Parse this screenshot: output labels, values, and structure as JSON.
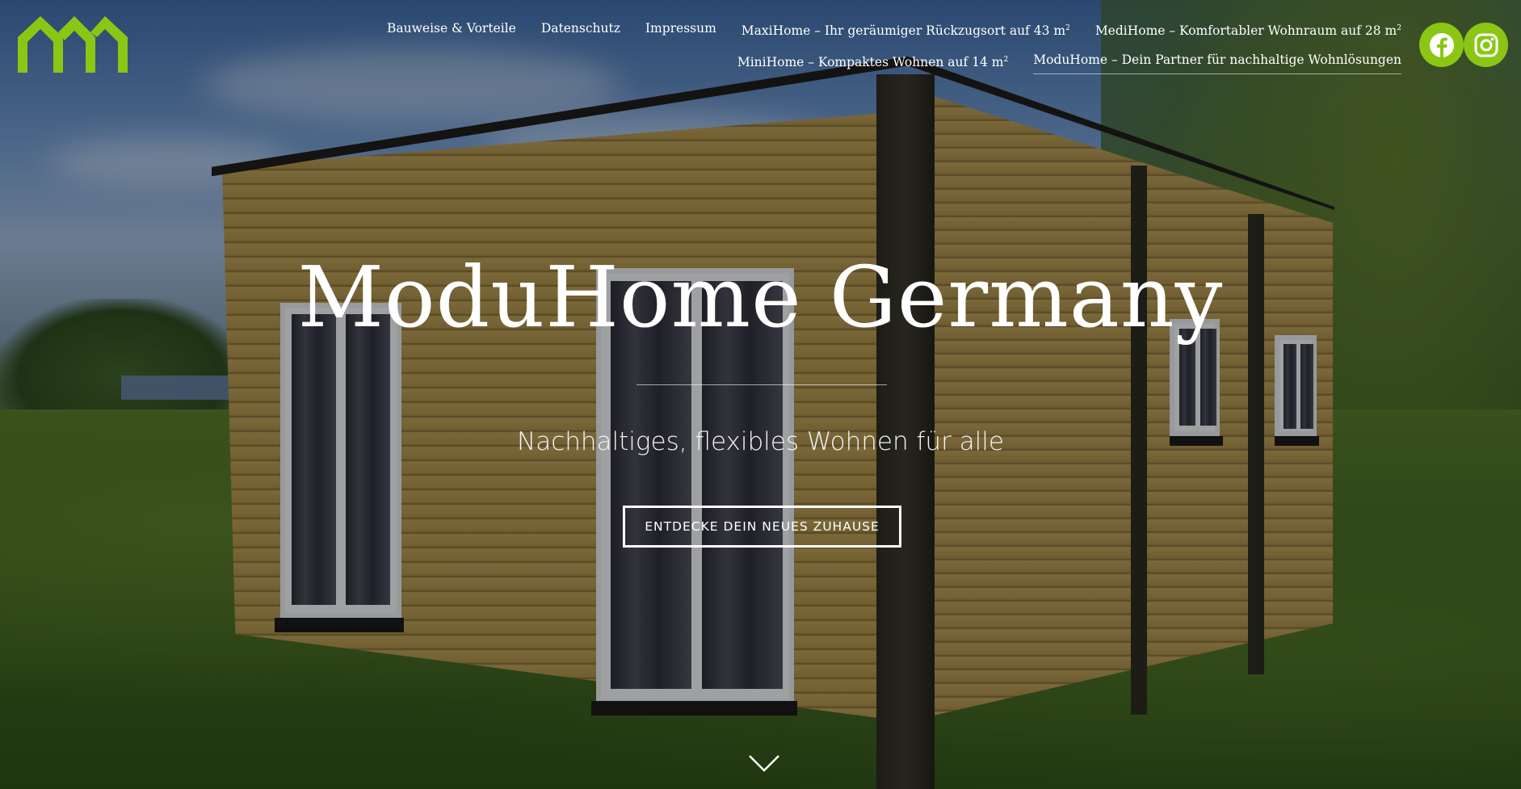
{
  "brand": {
    "logo_icon": "moduhome-logo-icon",
    "accent_color": "#8bc614"
  },
  "nav": {
    "items": [
      {
        "label": "Bauweise & Vorteile"
      },
      {
        "label": "Datenschutz"
      },
      {
        "label": "Impressum"
      },
      {
        "label": "MaxiHome – Ihr geräumiger Rückzugsort auf 43 m",
        "sup": "2"
      },
      {
        "label": "MediHome – Komfortabler Wohnraum auf 28 m",
        "sup": "2"
      },
      {
        "label": "MiniHome – Kompaktes Wohnen auf 14 m",
        "sup": "2"
      },
      {
        "label": "ModuHome – Dein Partner für nachhaltige Wohnlösungen"
      }
    ]
  },
  "social": {
    "facebook_icon": "facebook-icon",
    "instagram_icon": "instagram-icon"
  },
  "hero": {
    "title": "ModuHome Germany",
    "subtitle": "Nachhaltiges, flexibles Wohnen für alle",
    "cta_label": "ENTDECKE DEIN NEUES ZUHAUSE",
    "scroll_icon": "chevron-down-icon"
  }
}
